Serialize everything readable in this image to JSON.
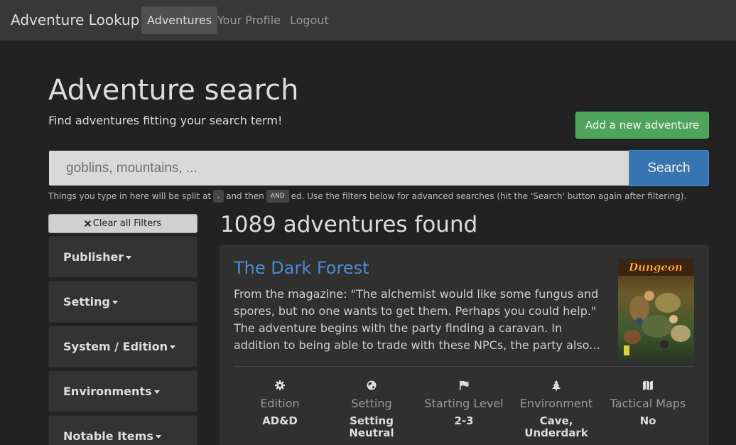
{
  "navbar": {
    "brand": "Adventure Lookup",
    "items": [
      {
        "label": "Adventures",
        "active": true
      },
      {
        "label": "Your Profile",
        "active": false
      },
      {
        "label": "Logout",
        "active": false
      }
    ]
  },
  "header": {
    "title": "Adventure search",
    "subtitle": "Find adventures fitting your search term!",
    "add_button": "Add a new adventure"
  },
  "search": {
    "placeholder": "goblins, mountains, ...",
    "value": "",
    "button": "Search",
    "hint_before": "Things you type in here will be split at",
    "hint_comma": ",",
    "hint_middle": "and then",
    "hint_and": "AND",
    "hint_after": "ed. Use the filters below for advanced searches (hit the 'Search' button again after filtering)."
  },
  "filters": {
    "clear_label": "Clear all Filters",
    "items": [
      "Publisher",
      "Setting",
      "System / Edition",
      "Environments",
      "Notable Items"
    ]
  },
  "results": {
    "count_label": "1089 adventures found"
  },
  "adventure": {
    "title": "The Dark Forest",
    "description": "From the magazine: \"The alchemist would like some fungus and spores, but no one wants to get them. Perhaps you could help.\" The adventure begins with the party finding a caravan. In addition to being able to trade with these NPCs, the party also...",
    "cover_text": "Dungeon",
    "stats": [
      {
        "icon": "gear-icon",
        "label": "Edition",
        "value": "AD&D"
      },
      {
        "icon": "globe-icon",
        "label": "Setting",
        "value": "Setting Neutral"
      },
      {
        "icon": "flag-icon",
        "label": "Starting Level",
        "value": "2-3"
      },
      {
        "icon": "tree-icon",
        "label": "Environment",
        "value": "Cave, Underdark"
      },
      {
        "icon": "map-icon",
        "label": "Tactical Maps",
        "value": "No"
      }
    ]
  },
  "colors": {
    "background": "#222222",
    "navbar": "#383838",
    "link": "#4a8bcf",
    "success": "#4ea45a",
    "primary": "#3a75b3"
  }
}
